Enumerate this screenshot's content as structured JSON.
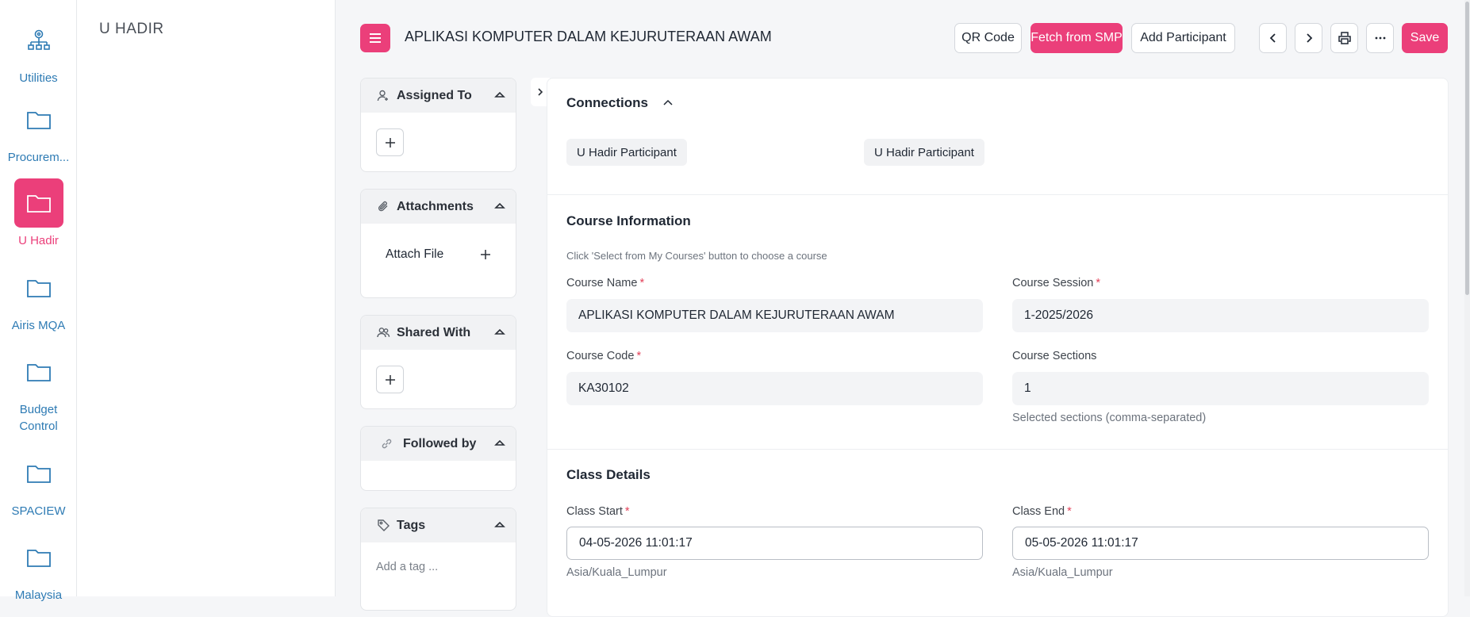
{
  "rail": {
    "items": [
      {
        "label": "Utilities",
        "icon": "network-icon"
      },
      {
        "label": "Procurem...",
        "icon": "folder-icon"
      },
      {
        "label": "U Hadir",
        "icon": "folder-icon",
        "active": true
      },
      {
        "label": "Airis MQA",
        "icon": "folder-icon"
      },
      {
        "label": "Budget\nControl",
        "label_line1": "Budget",
        "label_line2": "Control",
        "icon": "folder-icon"
      },
      {
        "label": "SPACIEW",
        "icon": "folder-icon"
      },
      {
        "label": "Malaysia",
        "icon": "folder-icon"
      }
    ]
  },
  "workspace": {
    "title": "U HADIR"
  },
  "header": {
    "title": "APLIKASI KOMPUTER DALAM KEJURUTERAAN AWAM",
    "buttons": {
      "qr_code": "QR Code",
      "fetch": "Fetch from SMP",
      "add_participant": "Add Participant",
      "save": "Save"
    }
  },
  "sidebar": {
    "assigned_to": "Assigned To",
    "attachments": "Attachments",
    "attach_file": "Attach File",
    "shared_with": "Shared With",
    "followed_by": "Followed by",
    "tags": "Tags",
    "add_tag_placeholder": "Add a tag ..."
  },
  "connections": {
    "title": "Connections",
    "chips": [
      "U Hadir Participant",
      "U Hadir Participant"
    ]
  },
  "course_info": {
    "title": "Course Information",
    "hint": "Click 'Select from My Courses' button to choose a course",
    "course_name_label": "Course Name",
    "course_name": "APLIKASI KOMPUTER DALAM KEJURUTERAAN AWAM",
    "course_session_label": "Course Session",
    "course_session": "1-2025/2026",
    "course_code_label": "Course Code",
    "course_code": "KA30102",
    "course_sections_label": "Course Sections",
    "course_sections": "1",
    "course_sections_help": "Selected sections (comma-separated)"
  },
  "class_details": {
    "title": "Class Details",
    "class_start_label": "Class Start",
    "class_start": "04-05-2026 11:01:17",
    "class_start_tz": "Asia/Kuala_Lumpur",
    "class_end_label": "Class End",
    "class_end": "05-05-2026 11:01:17",
    "class_end_tz": "Asia/Kuala_Lumpur"
  },
  "colors": {
    "accent": "#eb3f7a",
    "rail_link": "#2e7bb4",
    "required": "#e3425a"
  }
}
